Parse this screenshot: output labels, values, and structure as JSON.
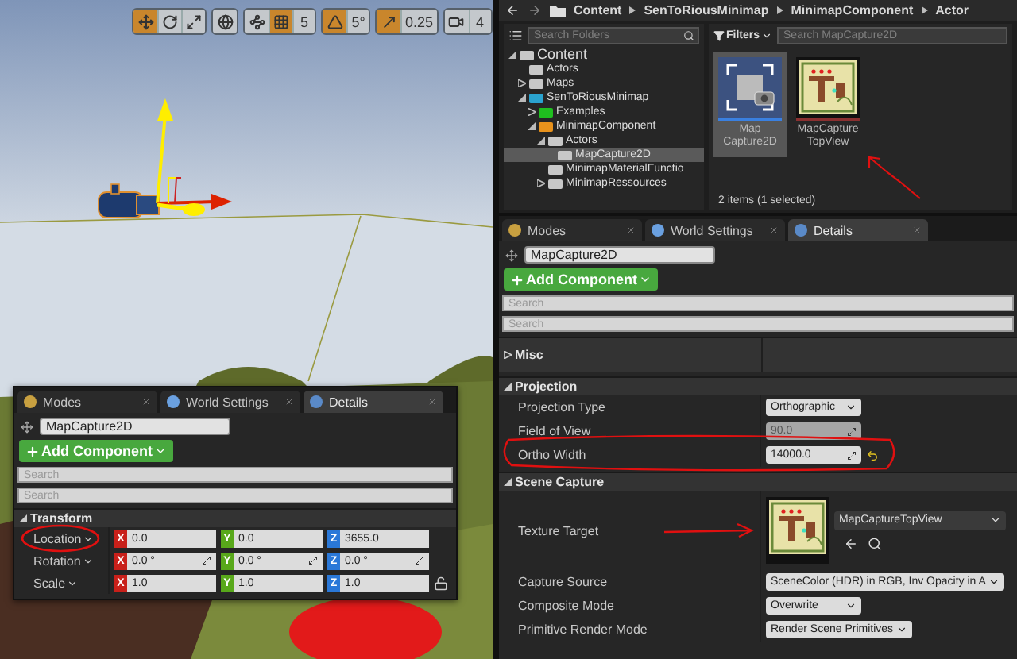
{
  "viewport": {
    "toolbar": {
      "groups": [
        {
          "items": [
            {
              "kind": "icon",
              "on": true
            },
            {
              "kind": "icon",
              "on": false
            },
            {
              "kind": "icon",
              "on": false
            }
          ]
        },
        {
          "items": [
            {
              "kind": "icon",
              "on": false
            }
          ]
        },
        {
          "items": [
            {
              "kind": "icon",
              "on": false
            },
            {
              "kind": "icon",
              "on": true
            },
            {
              "kind": "value",
              "text": "5"
            }
          ]
        },
        {
          "items": [
            {
              "kind": "icon",
              "on": true
            },
            {
              "kind": "value",
              "text": "5°"
            }
          ]
        },
        {
          "items": [
            {
              "kind": "icon",
              "on": true
            },
            {
              "kind": "value",
              "text": "0.25"
            }
          ]
        },
        {
          "items": [
            {
              "kind": "icon",
              "on": false
            },
            {
              "kind": "value",
              "text": "4"
            }
          ]
        }
      ]
    },
    "details": {
      "tabs": [
        {
          "label": "Modes",
          "selected": false
        },
        {
          "label": "World Settings",
          "selected": false
        },
        {
          "label": "Details",
          "selected": true
        }
      ],
      "object_name": "MapCapture2D",
      "add_component": "Add Component",
      "searches": [
        {
          "placeholder": "Search"
        },
        {
          "placeholder": "Search"
        }
      ],
      "sections": [
        {
          "title": "Transform",
          "expanded": true,
          "rows": [
            {
              "kind": "vector",
              "label": "Location",
              "circled": true,
              "fields": [
                {
                  "axis": "X",
                  "value": "0.0",
                  "spinner": false
                },
                {
                  "axis": "Y",
                  "value": "0.0",
                  "spinner": false
                },
                {
                  "axis": "Z",
                  "value": "3655.0",
                  "spinner": false
                }
              ]
            },
            {
              "kind": "vector",
              "label": "Rotation",
              "circled": false,
              "fields": [
                {
                  "axis": "X",
                  "value": "0.0 °",
                  "spinner": true
                },
                {
                  "axis": "Y",
                  "value": "0.0 °",
                  "spinner": true
                },
                {
                  "axis": "Z",
                  "value": "0.0 °",
                  "spinner": true
                }
              ]
            },
            {
              "kind": "vector",
              "label": "Scale",
              "circled": false,
              "locked": false,
              "fields": [
                {
                  "axis": "X",
                  "value": "1.0",
                  "spinner": false
                },
                {
                  "axis": "Y",
                  "value": "1.0",
                  "spinner": false
                },
                {
                  "axis": "Z",
                  "value": "1.0",
                  "spinner": false
                }
              ]
            }
          ]
        }
      ]
    }
  },
  "content_browser": {
    "breadcrumb": [
      "Content",
      "SenToRiousMinimap",
      "MinimapComponent",
      "Actor"
    ],
    "folder_search": {
      "placeholder": "Search Folders"
    },
    "folders": [
      {
        "label": "Content",
        "color": "#c8c8c8",
        "expanded": true,
        "selected": false,
        "children": [
          {
            "label": "Actors",
            "color": "#c8c8c8",
            "selected": false
          },
          {
            "label": "Maps",
            "color": "#c8c8c8",
            "expanded": false,
            "selected": false
          },
          {
            "label": "SenToRiousMinimap",
            "color": "#2aa3cf",
            "expanded": true,
            "selected": false,
            "children": [
              {
                "label": "Examples",
                "color": "#1fbf1f",
                "expanded": false,
                "selected": false
              },
              {
                "label": "MinimapComponent",
                "color": "#e8921c",
                "expanded": true,
                "selected": false,
                "children": [
                  {
                    "label": "Actors",
                    "color": "#c8c8c8",
                    "expanded": true,
                    "selected": false,
                    "children": [
                      {
                        "label": "MapCapture2D",
                        "color": "#c8c8c8",
                        "selected": true
                      }
                    ]
                  },
                  {
                    "label": "MinimapMaterialFunctio",
                    "color": "#c8c8c8",
                    "selected": false
                  },
                  {
                    "label": "MinimapRessources",
                    "color": "#c8c8c8",
                    "expanded": false,
                    "selected": false
                  }
                ]
              }
            ]
          }
        ]
      }
    ],
    "filters": "Filters",
    "asset_search": {
      "placeholder": "Search MapCapture2D"
    },
    "assets": [
      {
        "label": "Map Capture2D",
        "kind": "blueprint",
        "selected": true,
        "arrow": false
      },
      {
        "label": "MapCapture TopView",
        "kind": "texture",
        "selected": false,
        "arrow": true
      }
    ],
    "status": "2 items (1 selected)"
  },
  "details": {
    "tabs": [
      {
        "label": "Modes",
        "selected": false
      },
      {
        "label": "World Settings",
        "selected": false
      },
      {
        "label": "Details",
        "selected": true
      }
    ],
    "object_name": "MapCapture2D",
    "add_component": "Add Component",
    "searches": [
      {
        "placeholder": "Search"
      },
      {
        "placeholder": "Search"
      }
    ],
    "sections": [
      {
        "title": "Misc",
        "expanded": false
      },
      {
        "title": "Projection",
        "expanded": true,
        "rows": [
          {
            "kind": "dropdown",
            "label": "Projection Type",
            "value": "Orthographic",
            "circled": false
          },
          {
            "kind": "number",
            "label": "Field of View",
            "value": "90.0",
            "disabled": true,
            "spinner": true,
            "circled": false
          },
          {
            "kind": "number",
            "label": "Ortho Width",
            "value": "14000.0",
            "disabled": false,
            "spinner": true,
            "reset": true,
            "circled": true
          }
        ]
      },
      {
        "title": "Scene Capture",
        "expanded": true,
        "rows": [
          {
            "kind": "asset",
            "label": "Texture Target",
            "value": "MapCaptureTopView",
            "arrow": true,
            "circled": false
          },
          {
            "kind": "dropdown",
            "label": "Capture Source",
            "value": "SceneColor (HDR) in RGB, Inv Opacity in A",
            "circled": false
          },
          {
            "kind": "dropdown",
            "label": "Composite Mode",
            "value": "Overwrite",
            "circled": false
          },
          {
            "kind": "dropdown",
            "label": "Primitive Render Mode",
            "value": "Render Scene Primitives",
            "circled": false
          }
        ]
      }
    ]
  }
}
